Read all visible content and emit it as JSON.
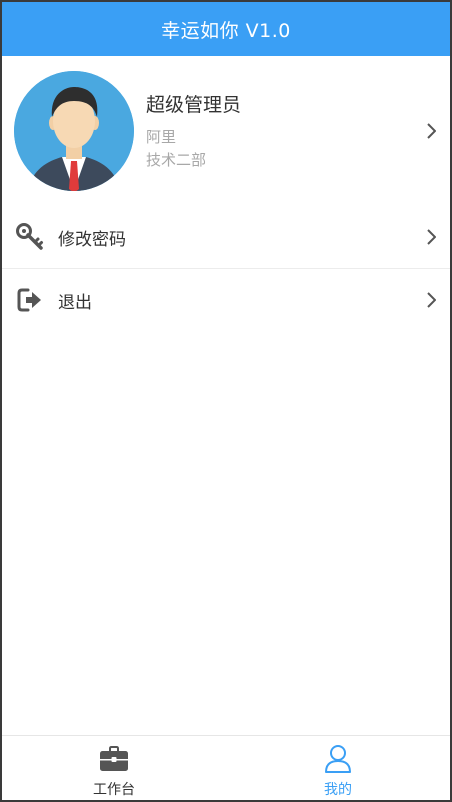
{
  "app": {
    "title": "幸运如你 V1.0"
  },
  "profile": {
    "name": "超级管理员",
    "company": "阿里",
    "department": "技术二部"
  },
  "menu": [
    {
      "label": "修改密码",
      "icon": "key-icon"
    },
    {
      "label": "退出",
      "icon": "logout-icon"
    }
  ],
  "tabs": [
    {
      "label": "工作台",
      "icon": "briefcase-icon",
      "active": false
    },
    {
      "label": "我的",
      "icon": "user-icon",
      "active": true
    }
  ],
  "colors": {
    "primary": "#3a9ff5",
    "text": "#333333",
    "subtext": "#a8a8a8",
    "icon": "#555555"
  }
}
